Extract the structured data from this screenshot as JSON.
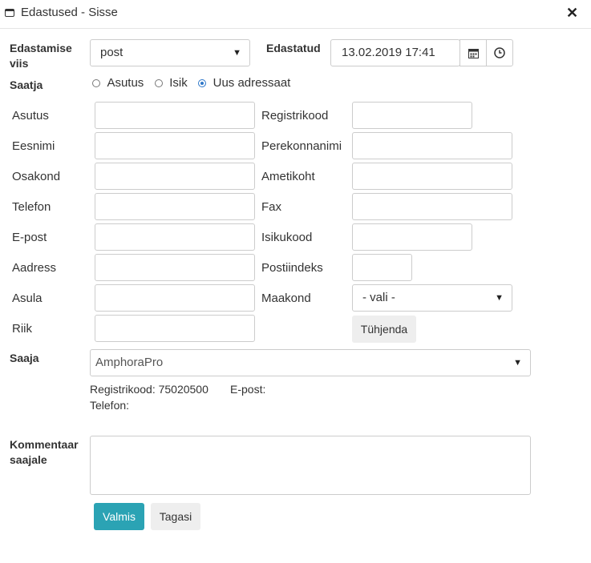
{
  "window": {
    "title": "Edastused - Sisse",
    "close_label": "✕"
  },
  "form": {
    "edastamise_viis_label": "Edastamise viis",
    "edastamise_viis_value": "post",
    "edastatud_label": "Edastatud",
    "edastatud_value": "13.02.2019 17:41",
    "saatja_label": "Saatja",
    "saatja_options": [
      "Asutus",
      "Isik",
      "Uus adressaat"
    ],
    "saatja_selected": "Uus adressaat",
    "fields_left": [
      "Asutus",
      "Eesnimi",
      "Osakond",
      "Telefon",
      "E-post",
      "Aadress",
      "Asula",
      "Riik"
    ],
    "fields_right": [
      "Registrikood",
      "Perekonnanimi",
      "Ametikoht",
      "Fax",
      "Isikukood",
      "Postiindeks",
      "Maakond"
    ],
    "maakond_value": "- vali -",
    "clear_button": "Tühjenda",
    "saaja_label": "Saaja",
    "saaja_value": "AmphoraPro",
    "saaja_registrikood": "Registrikood: 75020500",
    "saaja_epost": "E-post:",
    "saaja_telefon": "Telefon:",
    "kommentaar_label": "Kommentaar saajale",
    "kommentaar_value": ""
  },
  "actions": {
    "submit_label": "Valmis",
    "back_label": "Tagasi"
  },
  "icons": {
    "window": "window-icon",
    "calendar": "calendar-icon",
    "clock": "clock-icon",
    "dropdown": "chevron-down-icon"
  }
}
